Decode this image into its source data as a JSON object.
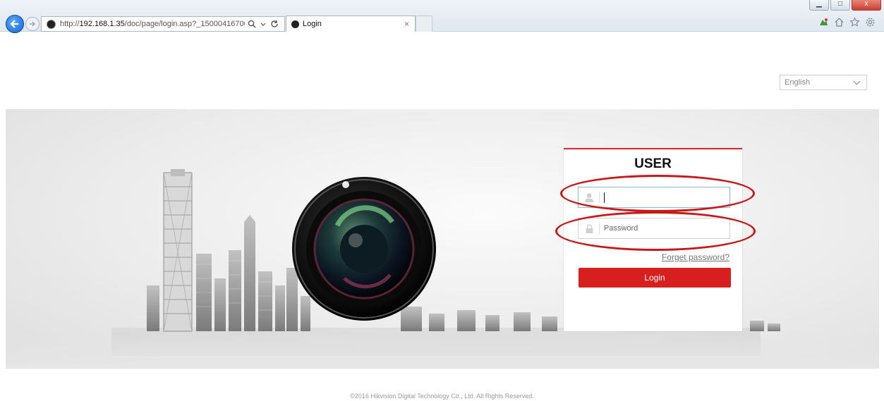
{
  "browser": {
    "url_prefix": "http://",
    "url_host": "192.168.1.35",
    "url_path": "/doc/page/login.asp?_15000416700!",
    "tab_title": "Login",
    "tab_close": "×",
    "window_min": "▁",
    "window_max": "□",
    "window_close": "x"
  },
  "page": {
    "language": "English",
    "login": {
      "title": "USER",
      "username_value": "",
      "password_placeholder": "Password",
      "forgot_label": "Forget password?",
      "login_label": "Login"
    },
    "footer": "©2016 Hikvision Digital Technology Co., Ltd. All Rights Reserved."
  },
  "annotation": {
    "color": "#c8191a"
  },
  "colors": {
    "accent": "#d71f1f",
    "card_border": "#d42a2a"
  }
}
